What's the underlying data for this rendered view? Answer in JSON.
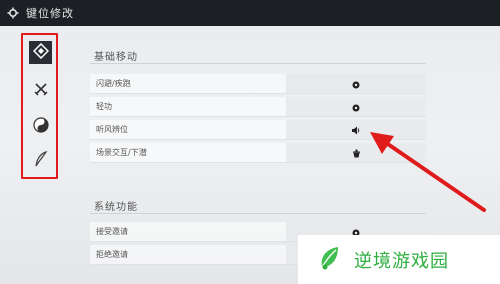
{
  "window": {
    "title": "键位修改",
    "icon": "gear-icon"
  },
  "sidebar": {
    "items": [
      {
        "icon": "diamond-icon",
        "active": true
      },
      {
        "icon": "crossed-swords-icon",
        "active": false
      },
      {
        "icon": "yin-yang-icon",
        "active": false
      },
      {
        "icon": "feather-icon",
        "active": false
      }
    ]
  },
  "sections": [
    {
      "title": "基础移动",
      "rows": [
        {
          "label": "闪避/疾跑",
          "key_icon": "mouse-icon"
        },
        {
          "label": "轻功",
          "key_icon": "mouse-icon"
        },
        {
          "label": "听风辨位",
          "key_icon": "listen-icon"
        },
        {
          "label": "场景交互/下潜",
          "key_icon": "bowl-icon"
        }
      ]
    },
    {
      "title": "系统功能",
      "rows": [
        {
          "label": "接受邀请",
          "key_icon": "mouse-icon"
        },
        {
          "label": "拒绝邀请",
          "key_icon": ""
        }
      ]
    }
  ],
  "annotation": {
    "arrow_color": "#e01b1b",
    "frame_color": "#e01b1b"
  },
  "watermark": {
    "text": "逆境游戏园",
    "color": "#2fae3e",
    "logo": "leaf-logo-icon"
  }
}
